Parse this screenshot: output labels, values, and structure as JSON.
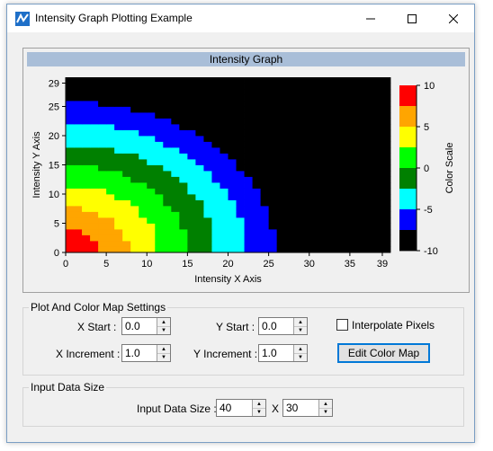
{
  "window": {
    "title": "Intensity Graph Plotting Example"
  },
  "graph": {
    "title": "Intensity Graph",
    "colorscale_label": "Color Scale"
  },
  "chart_data": {
    "type": "heatmap",
    "title": "Intensity Graph",
    "xlabel": "Intensity X Axis",
    "ylabel": "Intensity Y Axis",
    "xlim": [
      0,
      39
    ],
    "ylim": [
      0,
      29
    ],
    "x_ticks": [
      "0",
      "5",
      "10",
      "15",
      "20",
      "25",
      "30",
      "35",
      "39"
    ],
    "y_ticks": [
      "0",
      "5",
      "10",
      "15",
      "20",
      "25",
      "29"
    ],
    "grid_size": {
      "nx": 40,
      "ny": 30
    },
    "data_model": "z = 10*cos(0.079*sqrt(x^2+y^2)) approx; concentric rings centered at origin",
    "color_scale": {
      "label": "Color Scale",
      "ticks": [
        "10",
        "5",
        "0",
        "-5",
        "-10"
      ],
      "levels": [
        {
          "value": 10,
          "color": "#ff0000"
        },
        {
          "value": 7.5,
          "color": "#ffa500"
        },
        {
          "value": 5,
          "color": "#ffff00"
        },
        {
          "value": 2.5,
          "color": "#00ff00"
        },
        {
          "value": 0,
          "color": "#008000"
        },
        {
          "value": -2.5,
          "color": "#00ffff"
        },
        {
          "value": -5,
          "color": "#0000ff"
        },
        {
          "value": -7.5,
          "color": "#000000"
        }
      ]
    }
  },
  "settings": {
    "group_title": "Plot And Color Map Settings",
    "x_start_label": "X Start :",
    "x_start_value": "0.0",
    "y_start_label": "Y Start :",
    "y_start_value": "0.0",
    "x_increment_label": "X Increment :",
    "x_increment_value": "1.0",
    "y_increment_label": "Y Increment :",
    "y_increment_value": "1.0",
    "interpolate_label": "Interpolate Pixels",
    "edit_color_map_label": "Edit Color Map"
  },
  "input_size": {
    "group_title": "Input Data Size",
    "label": "Input Data Size :",
    "width_value": "40",
    "separator": "X",
    "height_value": "30"
  }
}
